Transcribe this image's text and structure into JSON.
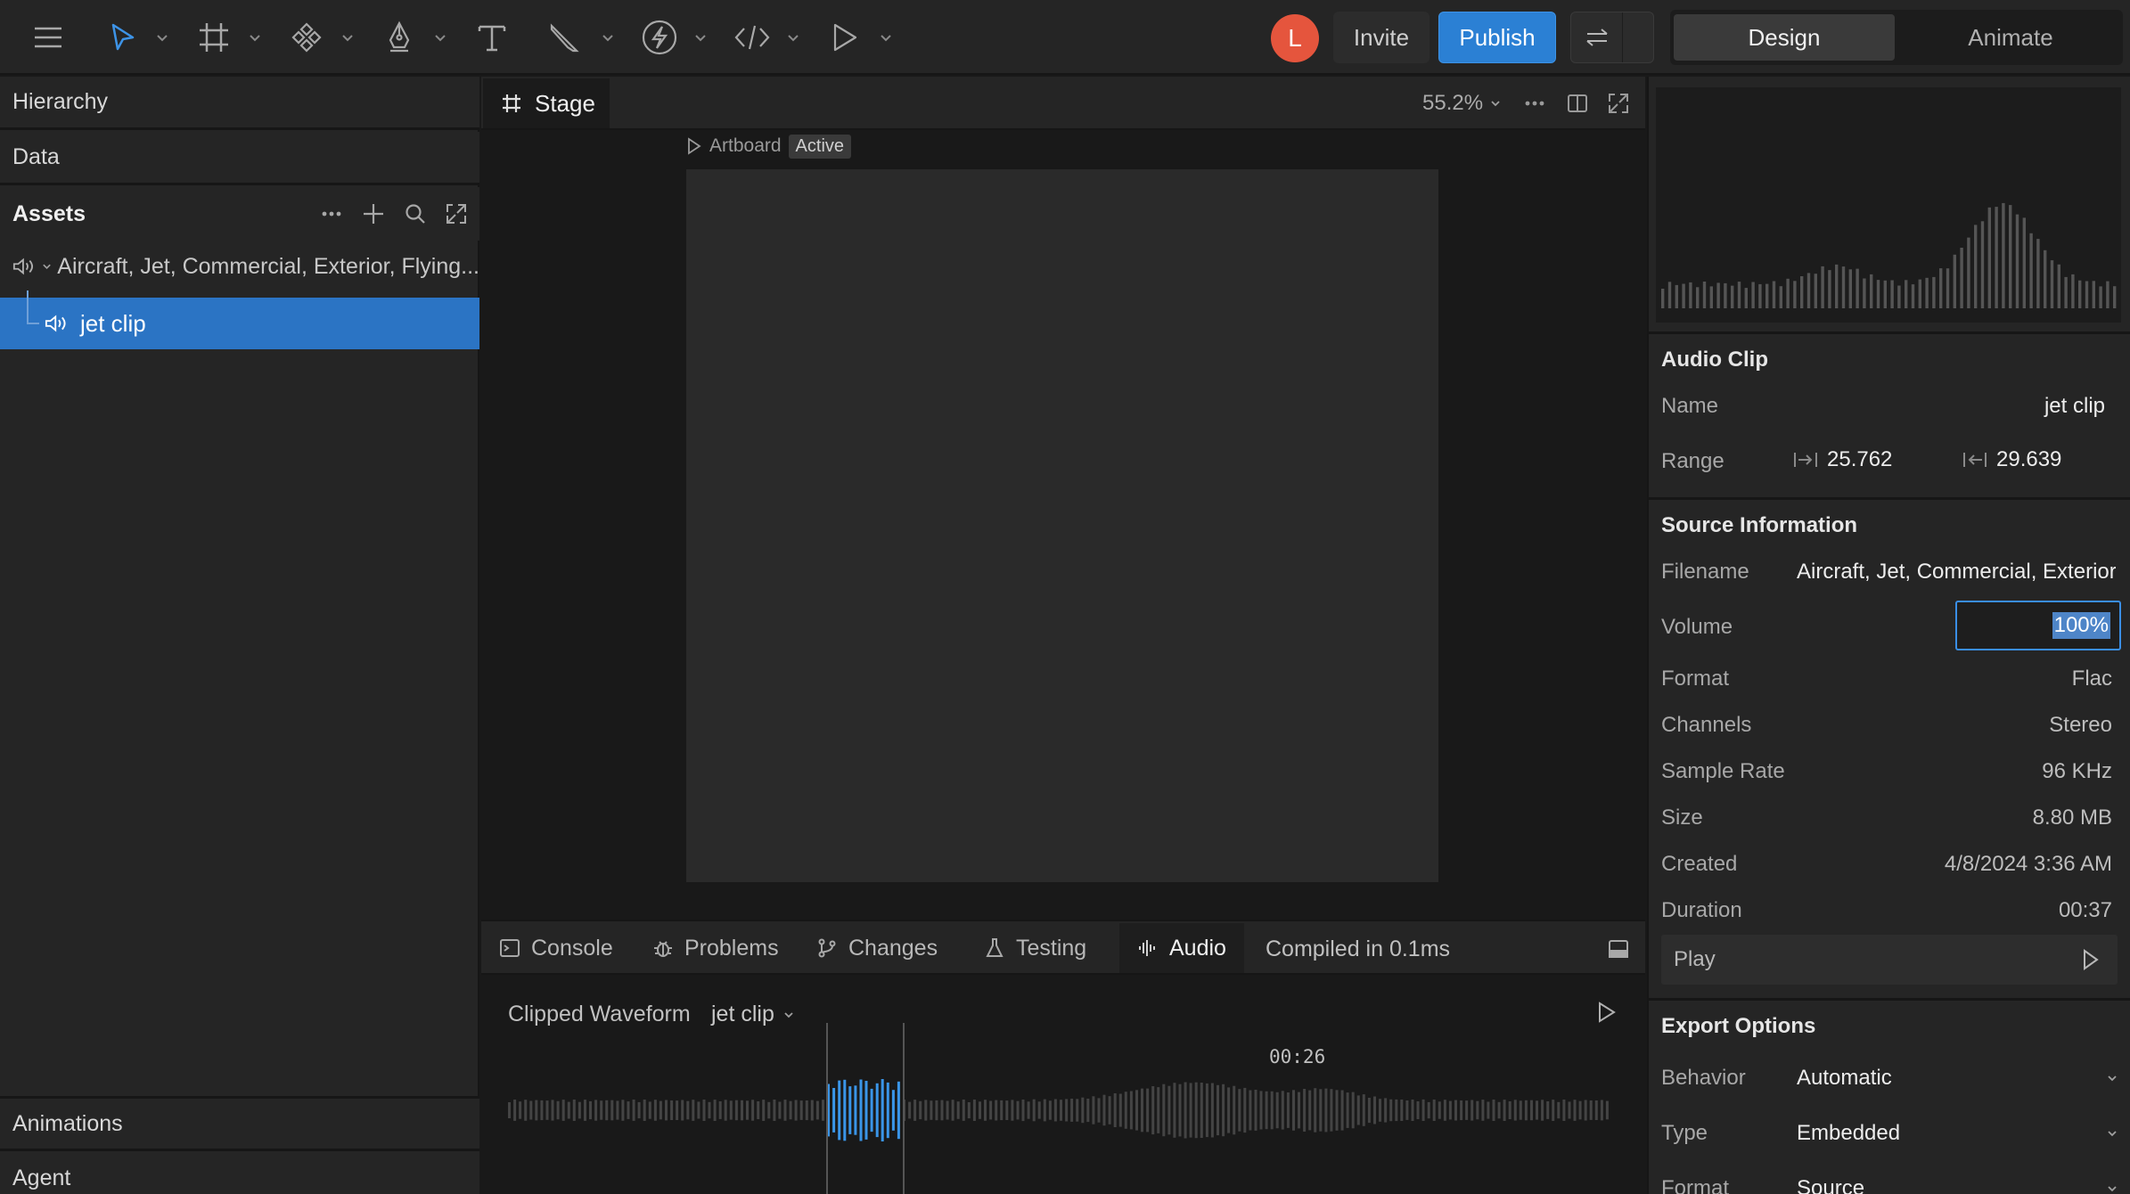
{
  "toolbar": {
    "avatar_initial": "L",
    "invite_label": "Invite",
    "publish_label": "Publish",
    "modes": {
      "design": "Design",
      "animate": "Animate"
    },
    "accent_color": "#2b80d4",
    "tools": [
      "menu-icon",
      "select-pointer-icon",
      "frame-icon",
      "component-icon",
      "pen-icon",
      "text-icon",
      "brush-icon",
      "lightning-icon",
      "code-icon",
      "play-icon"
    ]
  },
  "left_panel": {
    "hierarchy": "Hierarchy",
    "data": "Data",
    "assets": "Assets",
    "asset_folder": "Aircraft, Jet, Commercial, Exterior, Flying...",
    "selected_asset": "jet clip",
    "animations": "Animations",
    "agent": "Agent"
  },
  "stage": {
    "tab_label": "Stage",
    "zoom": "55.2%",
    "artboard_label": "Artboard",
    "artboard_status": "Active"
  },
  "bottom_panel": {
    "tabs": {
      "console": "Console",
      "problems": "Problems",
      "changes": "Changes",
      "testing": "Testing",
      "audio": "Audio"
    },
    "compiled": "Compiled in 0.1ms",
    "waveform_title": "Clipped Waveform",
    "waveform_clip": "jet clip",
    "playhead_time": "00:26"
  },
  "audio_clip": {
    "section": "Audio Clip",
    "name_label": "Name",
    "name": "jet clip",
    "range_label": "Range",
    "range_start": "25.762",
    "range_end": "29.639"
  },
  "source_info": {
    "section": "Source Information",
    "filename_label": "Filename",
    "filename": "Aircraft, Jet, Commercial, Exterior",
    "volume_label": "Volume",
    "volume": "100%",
    "format_label": "Format",
    "format": "Flac",
    "channels_label": "Channels",
    "channels": "Stereo",
    "sample_rate_label": "Sample Rate",
    "sample_rate": "96 KHz",
    "size_label": "Size",
    "size": "8.80 MB",
    "created_label": "Created",
    "created": "4/8/2024 3:36 AM",
    "duration_label": "Duration",
    "duration": "00:37",
    "play_label": "Play"
  },
  "export_options": {
    "section": "Export Options",
    "behavior_label": "Behavior",
    "behavior": "Automatic",
    "type_label": "Type",
    "type": "Embedded",
    "format_label": "Format",
    "format": "Source"
  }
}
